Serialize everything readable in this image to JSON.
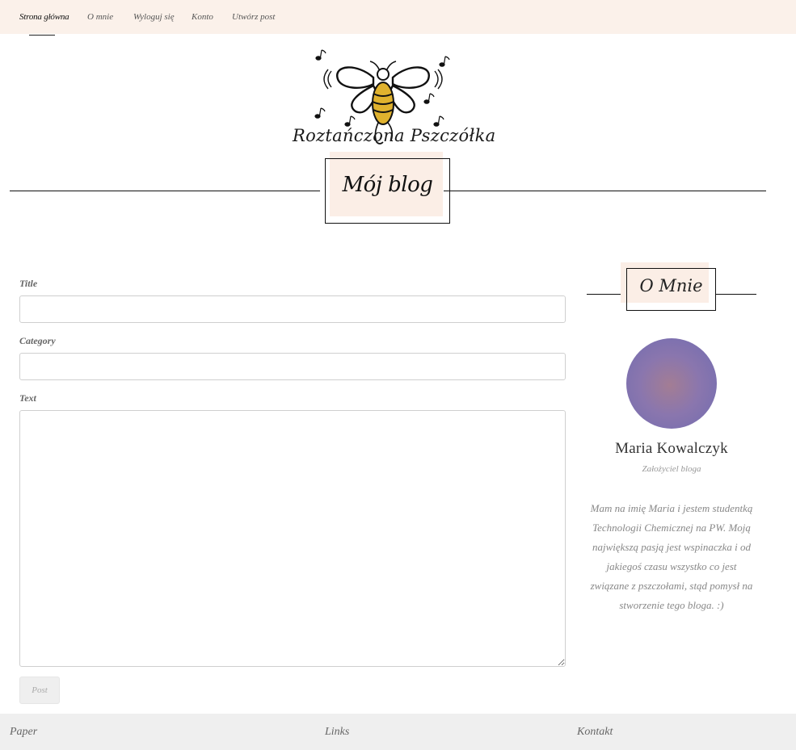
{
  "nav": {
    "items": [
      {
        "label": "Strona główna",
        "active": true
      },
      {
        "label": "O mnie",
        "active": false
      },
      {
        "label": "Wyloguj się",
        "active": false
      },
      {
        "label": "Konto",
        "active": false
      },
      {
        "label": "Utwórz post",
        "active": false
      }
    ]
  },
  "logo": {
    "text": "Roztańczona Pszczółka"
  },
  "blog": {
    "title": "Mój blog"
  },
  "form": {
    "title_label": "Title",
    "title_value": "",
    "category_label": "Category",
    "category_value": "",
    "text_label": "Text",
    "text_value": "",
    "submit_label": "Post"
  },
  "sidebar": {
    "title": "O Mnie",
    "author_name": "Maria Kowalczyk",
    "author_role": "Założyciel bloga",
    "bio": "Mam na imię Maria i jestem studentką Technologii Chemicznej na PW. Moją największą pasją jest wspinaczka i od jakiegoś czasu wszystko co jest związane z pszczołami, stąd pomysł na stworzenie tego bloga. :)"
  },
  "footer": {
    "col1": "Paper",
    "col2": "Links",
    "col3": "Kontakt"
  },
  "colors": {
    "nav_bg": "#fbf1ea",
    "accent_bg": "#fbeee6",
    "footer_bg": "#efefef",
    "bee_body": "#e0b22e"
  }
}
